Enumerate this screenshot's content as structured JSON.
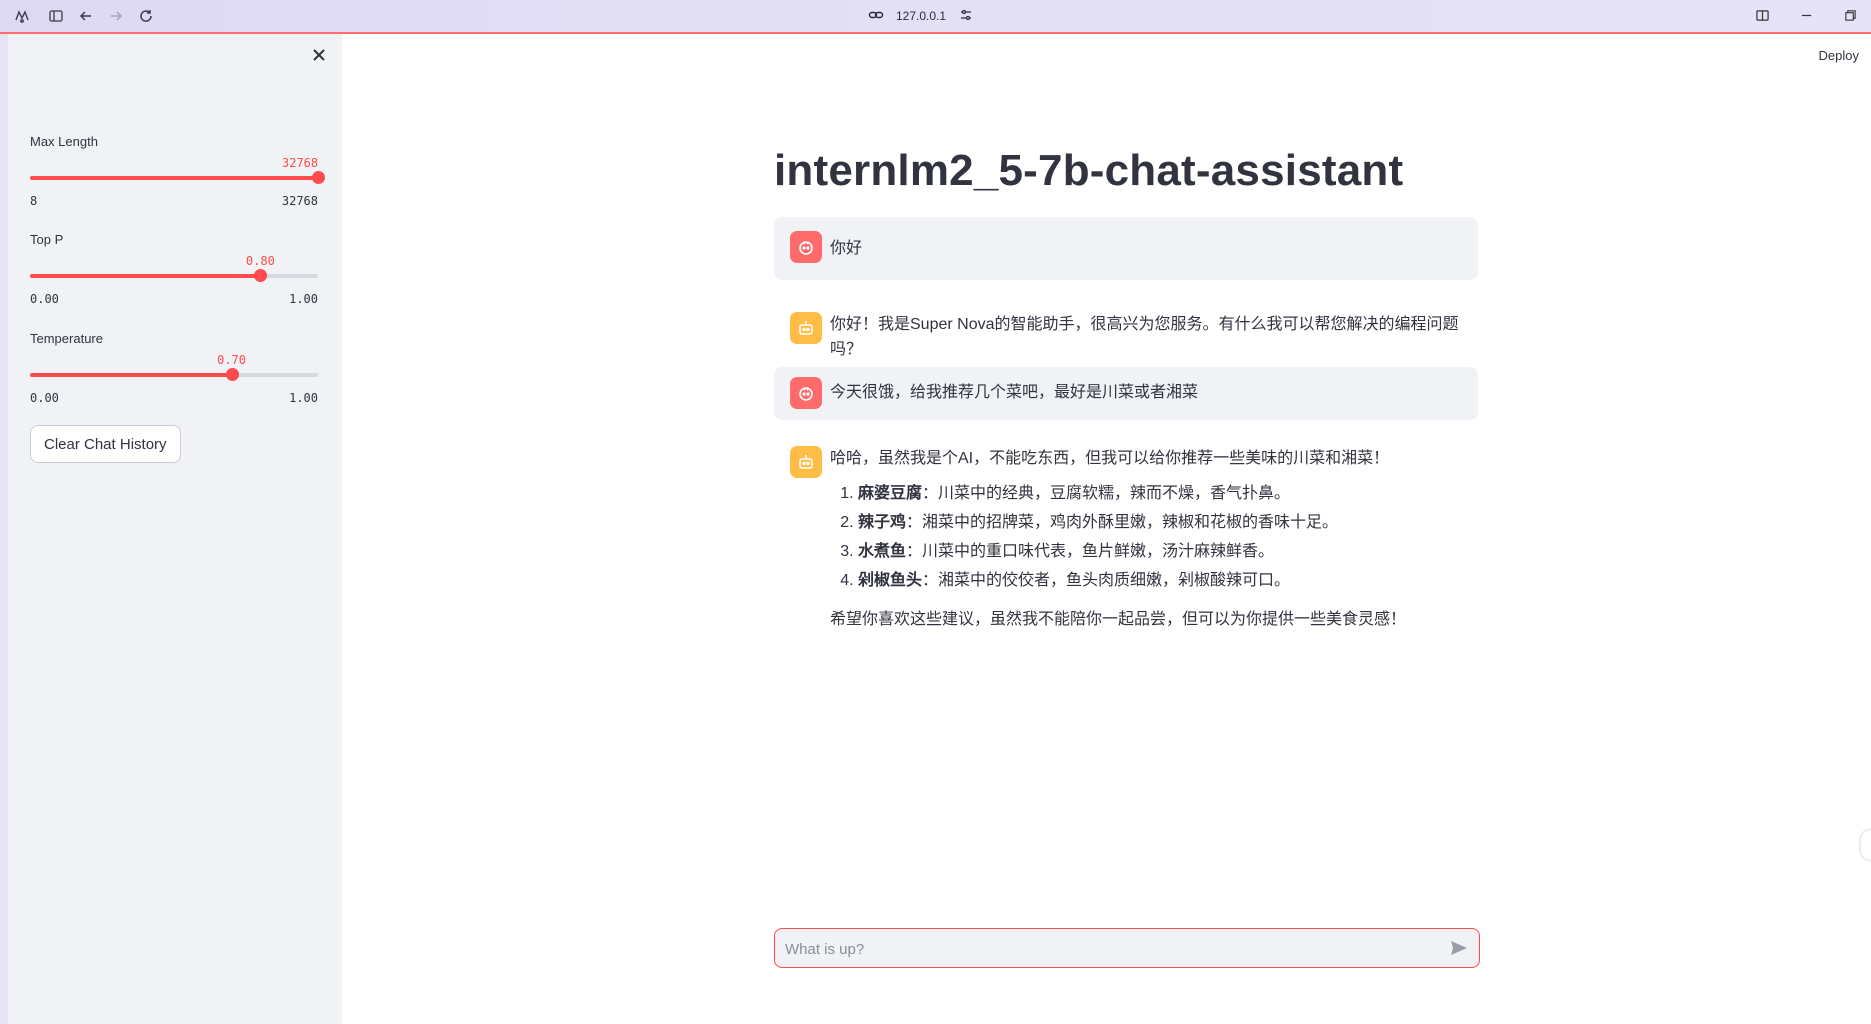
{
  "browser": {
    "url": "127.0.0.1"
  },
  "sidebar": {
    "sliders": [
      {
        "label": "Max Length",
        "value": "32768",
        "min": "8",
        "max": "32768",
        "fraction": 1.0
      },
      {
        "label": "Top P",
        "value": "0.80",
        "min": "0.00",
        "max": "1.00",
        "fraction": 0.8
      },
      {
        "label": "Temperature",
        "value": "0.70",
        "min": "0.00",
        "max": "1.00",
        "fraction": 0.7
      }
    ],
    "clear_button": "Clear Chat History"
  },
  "header": {
    "deploy": "Deploy"
  },
  "main": {
    "title": "internlm2_5-7b-chat-assistant",
    "messages": [
      {
        "role": "user",
        "text": "你好"
      },
      {
        "role": "assistant",
        "text": "你好！我是Super Nova的智能助手，很高兴为您服务。有什么我可以帮您解决的编程问题吗？"
      },
      {
        "role": "user",
        "text": "今天很饿，给我推荐几个菜吧，最好是川菜或者湘菜"
      },
      {
        "role": "assistant",
        "intro": "哈哈，虽然我是个AI，不能吃东西，但我可以给你推荐一些美味的川菜和湘菜！",
        "items": [
          {
            "name": "麻婆豆腐",
            "desc": "：川菜中的经典，豆腐软糯，辣而不燥，香气扑鼻。"
          },
          {
            "name": "辣子鸡",
            "desc": "：湘菜中的招牌菜，鸡肉外酥里嫩，辣椒和花椒的香味十足。"
          },
          {
            "name": "水煮鱼",
            "desc": "：川菜中的重口味代表，鱼片鲜嫩，汤汁麻辣鲜香。"
          },
          {
            "name": "剁椒鱼头",
            "desc": "：湘菜中的佼佼者，鱼头肉质细嫩，剁椒酸辣可口。"
          }
        ],
        "closing": "希望你喜欢这些建议，虽然我不能陪你一起品尝，但可以为你提供一些美食灵感！"
      }
    ],
    "input_placeholder": "What is up?"
  },
  "colors": {
    "accent": "#ff4b4b",
    "sidebar_bg": "#f0f2f6",
    "user_avatar": "#ff6b6b",
    "bot_avatar": "#ffbd45"
  }
}
